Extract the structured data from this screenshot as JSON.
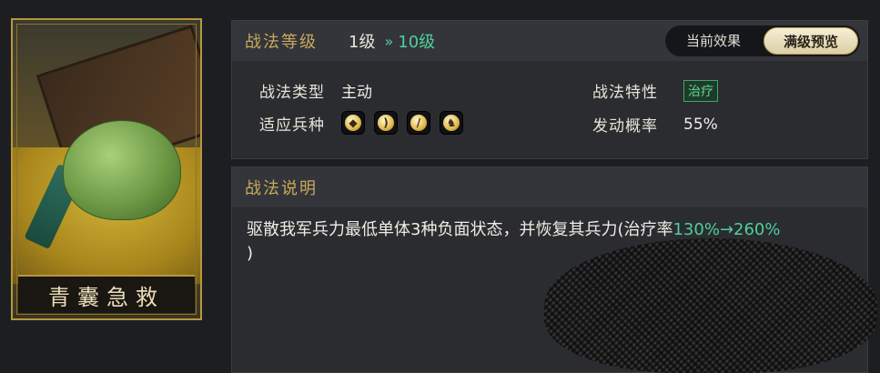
{
  "card": {
    "name": "青囊急救"
  },
  "skill": {
    "level_label": "战法等级",
    "level_from": "1级",
    "level_arrows": "»",
    "level_to": "10级",
    "toggle": {
      "current": "当前效果",
      "max": "满级预览",
      "active": "max"
    },
    "type_label": "战法类型",
    "type_value": "主动",
    "trait_label": "战法特性",
    "trait_value": "治疗",
    "troops_label": "适应兵种",
    "troops": [
      "shield-icon",
      "bow-icon",
      "spear-icon",
      "horse-icon"
    ],
    "chance_label": "发动概率",
    "chance_value": "55%"
  },
  "description": {
    "header": "战法说明",
    "text_main": "驱散我军兵力最低单体3种负面状态，并恢复其兵力(治疗率",
    "text_green": "130%→260%",
    "text_end": ")"
  },
  "colors": {
    "accent_gold": "#c9a85c",
    "accent_green": "#4fcf9a",
    "frame_gold": "#b8973e"
  }
}
